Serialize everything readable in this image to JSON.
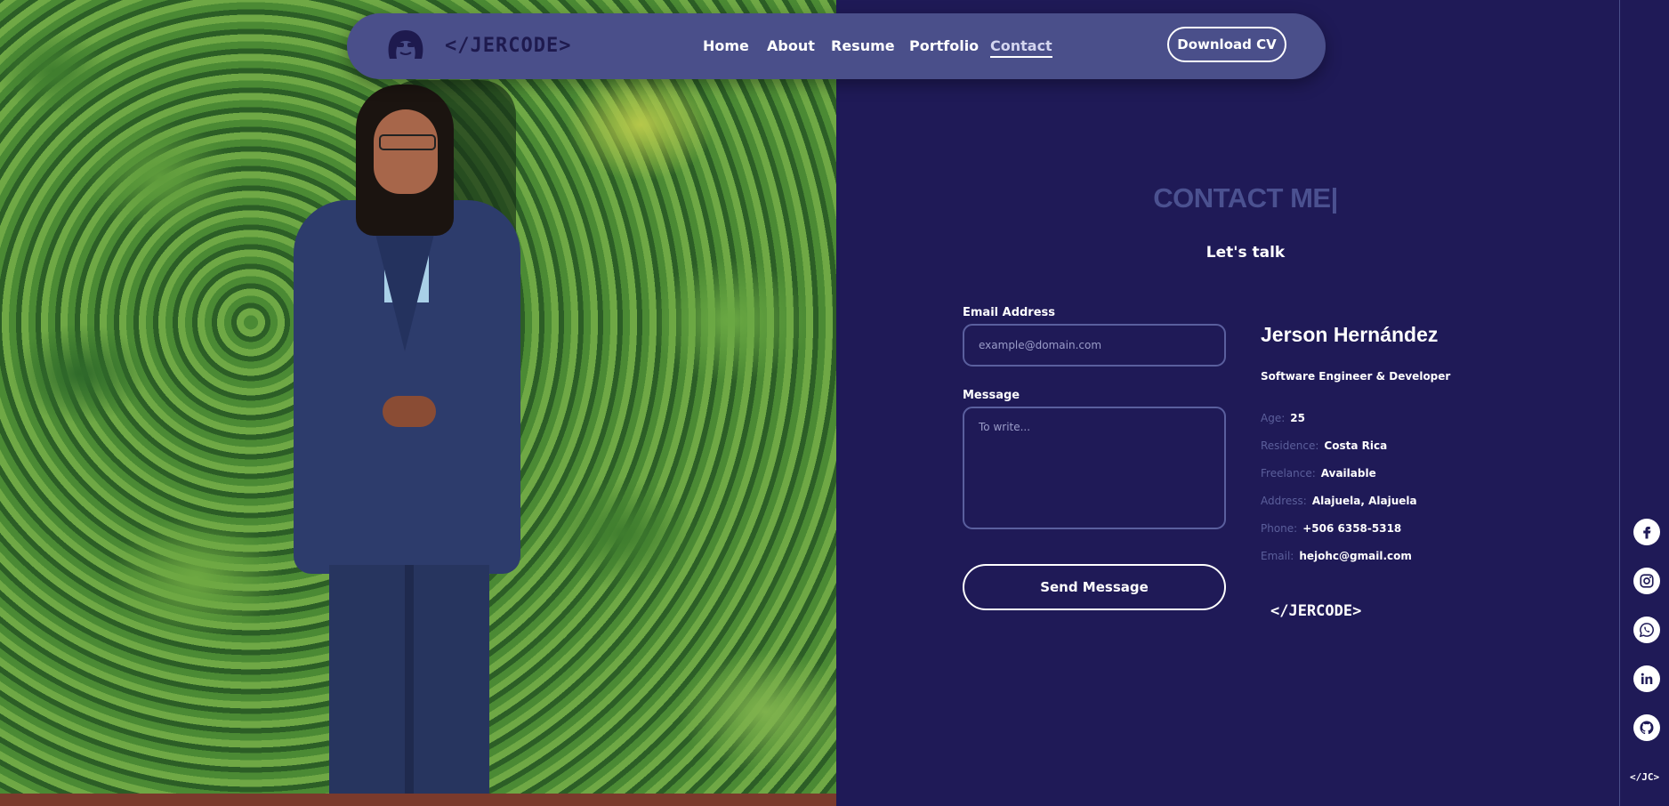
{
  "brand": {
    "logo_text": "</JERCODE>",
    "footer_logo": "</JERCODE>",
    "rail_logo": "</JC>"
  },
  "nav": {
    "links": [
      {
        "label": "Home"
      },
      {
        "label": "About"
      },
      {
        "label": "Resume"
      },
      {
        "label": "Portfolio"
      },
      {
        "label": "Contact",
        "active": true
      }
    ],
    "cv_button": "Download CV"
  },
  "contact": {
    "title": "CONTACT ME|",
    "subtitle": "Let's talk",
    "form": {
      "email_label": "Email Address",
      "email_placeholder": "example@domain.com",
      "message_label": "Message",
      "message_placeholder": "To write...",
      "send_button": "Send Message"
    }
  },
  "profile": {
    "name": "Jerson Hernández",
    "role": "Software Engineer & Developer",
    "info": [
      {
        "key": "Age:",
        "value": "25"
      },
      {
        "key": "Residence:",
        "value": "Costa Rica"
      },
      {
        "key": "Freelance:",
        "value": "Available"
      },
      {
        "key": "Address:",
        "value": "Alajuela, Alajuela"
      },
      {
        "key": "Phone:",
        "value": "+506 6358-5318"
      },
      {
        "key": "Email:",
        "value": "hejohc@gmail.com"
      }
    ]
  },
  "social": [
    "facebook-icon",
    "instagram-icon",
    "whatsapp-icon",
    "linkedin-icon",
    "github-icon"
  ],
  "colors": {
    "background": "#1f1a57",
    "navbar": "#4a4f8a",
    "title": "#4b5190",
    "muted": "#5b5f9b"
  }
}
